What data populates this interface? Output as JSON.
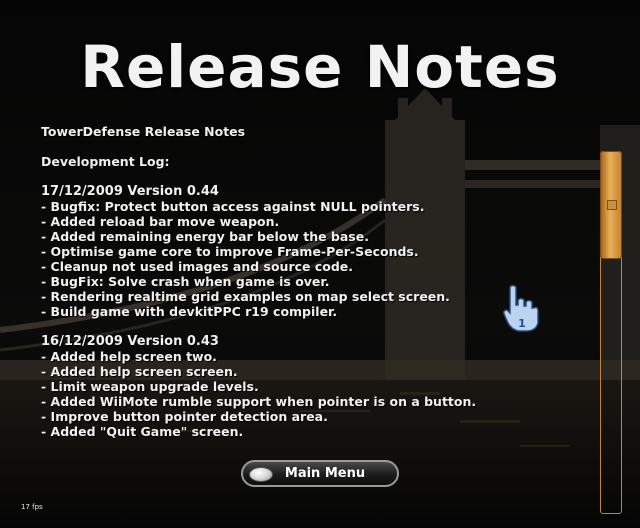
{
  "title": "Release Notes",
  "notes": {
    "header": "TowerDefense Release Notes",
    "log_title": "Development Log:",
    "versions": [
      {
        "heading": "17/12/2009 Version 0.44",
        "items": [
          "- Bugfix: Protect button access against NULL pointers.",
          "- Added reload bar move weapon.",
          "- Added remaining energy bar below the base.",
          "- Optimise game core to improve Frame-Per-Seconds.",
          "- Cleanup not used images and source code.",
          "- BugFix: Solve crash when game is over.",
          "- Rendering realtime grid examples on map select screen.",
          "- Build game with devkitPPC r19 compiler."
        ]
      },
      {
        "heading": "16/12/2009 Version 0.43",
        "items": [
          "- Added help screen two.",
          "- Added help screen screen.",
          "- Limit weapon upgrade levels.",
          "- Added WiiMote rumble support when pointer is on a button.",
          "- Improve button pointer detection area.",
          "- Added \"Quit Game\" screen."
        ]
      }
    ]
  },
  "menu_button": {
    "label": "Main Menu"
  },
  "cursor": {
    "icon": "wiimote-hand-pointer-icon",
    "player": "1"
  },
  "fps": "17 fps",
  "colors": {
    "text": "#f0f0f0",
    "scroll_accent": "#c7813a",
    "cursor": "#b9d3f0"
  }
}
